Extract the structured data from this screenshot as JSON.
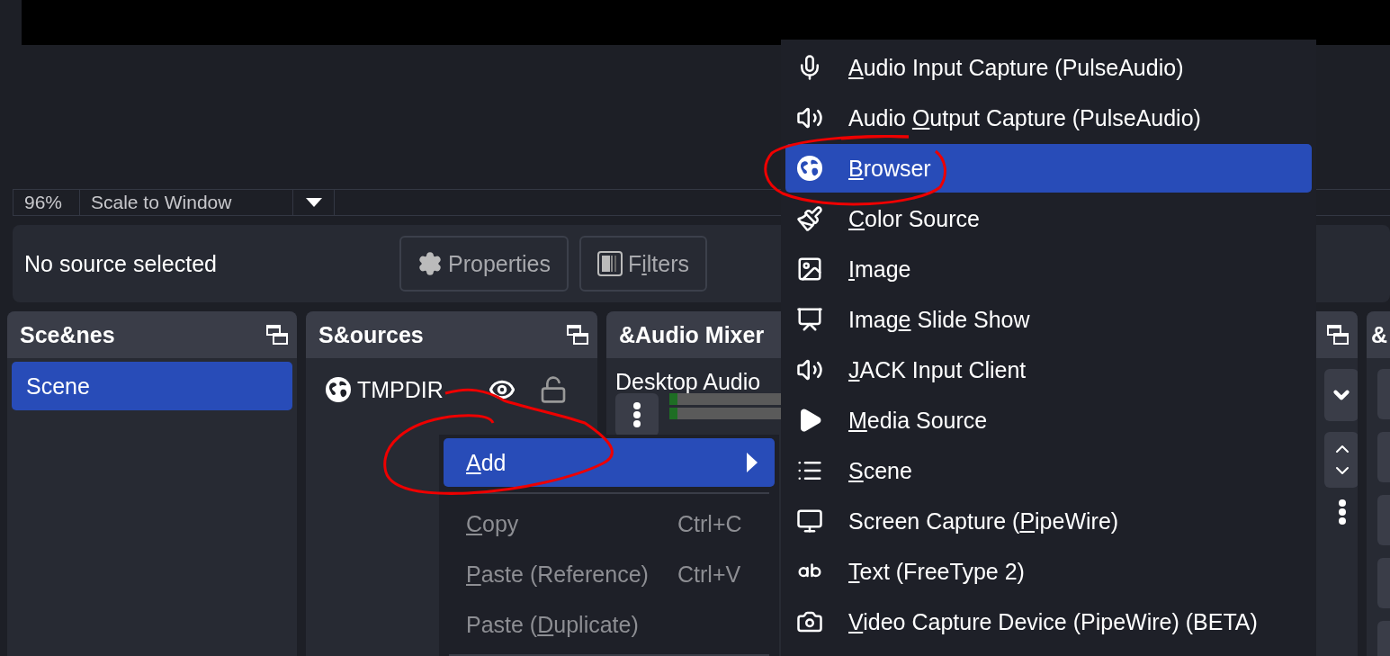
{
  "zoom_bar": {
    "zoom": "96%",
    "mode": "Scale to Window"
  },
  "context_bar": {
    "status": "No source selected",
    "buttons": [
      {
        "kind": "properties",
        "pre": "Properties",
        "disabled": true
      },
      {
        "kind": "filters",
        "pre": "F",
        "key": "i",
        "post": "lters",
        "disabled": true
      }
    ]
  },
  "scenes_dock": {
    "title": "Sce&nes",
    "items": [
      {
        "label": "Scene",
        "selected": true
      }
    ]
  },
  "sources_dock": {
    "title": "S&ources",
    "items": [
      {
        "label": "TMPDIR",
        "visible": true,
        "locked": false
      }
    ]
  },
  "mixer_dock": {
    "title": "&Audio Mixer",
    "channels": [
      {
        "name": "Desktop Audio",
        "level": 0.02
      }
    ]
  },
  "last_dock": {
    "title": "&"
  },
  "context_menu": [
    {
      "kind": "item",
      "key": "A",
      "post": "dd",
      "selected": true,
      "disabled": false,
      "submenu": true
    },
    {
      "kind": "separator"
    },
    {
      "kind": "item",
      "key": "C",
      "post": "opy",
      "shortcut": "Ctrl+C",
      "selected": false,
      "disabled": true,
      "submenu": false
    },
    {
      "kind": "item",
      "key": "P",
      "post": "aste (Reference)",
      "shortcut": "Ctrl+V",
      "selected": false,
      "disabled": true,
      "submenu": false
    },
    {
      "kind": "item",
      "pre": "Paste (",
      "key": "D",
      "post": "uplicate)",
      "selected": false,
      "disabled": true,
      "submenu": false
    },
    {
      "kind": "separator"
    }
  ],
  "add_submenu": [
    {
      "kind": "mic",
      "key": "A",
      "post": "udio Input Capture (PulseAudio)",
      "selected": false
    },
    {
      "kind": "speaker",
      "pre": "Audio ",
      "key": "O",
      "post": "utput Capture (PulseAudio)",
      "selected": false
    },
    {
      "kind": "globe",
      "key": "B",
      "post": "rowser",
      "selected": true
    },
    {
      "kind": "brush",
      "key": "C",
      "post": "olor Source",
      "selected": false
    },
    {
      "kind": "image",
      "key": "I",
      "post": "mage",
      "selected": false
    },
    {
      "kind": "slideshow",
      "pre": "Imag",
      "key": "e",
      "post": " Slide Show",
      "selected": false
    },
    {
      "kind": "speaker",
      "key": "J",
      "post": "ACK Input Client",
      "selected": false
    },
    {
      "kind": "play",
      "key": "M",
      "post": "edia Source",
      "selected": false
    },
    {
      "kind": "list",
      "key": "S",
      "post": "cene",
      "selected": false
    },
    {
      "kind": "monitor",
      "pre": "Screen Capture (",
      "key": "P",
      "post": "ipeWire)",
      "selected": false
    },
    {
      "kind": "text",
      "key": "T",
      "post": "ext (FreeType 2)",
      "selected": false
    },
    {
      "kind": "camera",
      "key": "V",
      "post": "ideo Capture Device (PipeWire) (BETA)",
      "selected": false
    }
  ],
  "annotations": [
    {
      "kind": "underline"
    },
    {
      "kind": "ellipse"
    },
    {
      "kind": "loop"
    }
  ]
}
